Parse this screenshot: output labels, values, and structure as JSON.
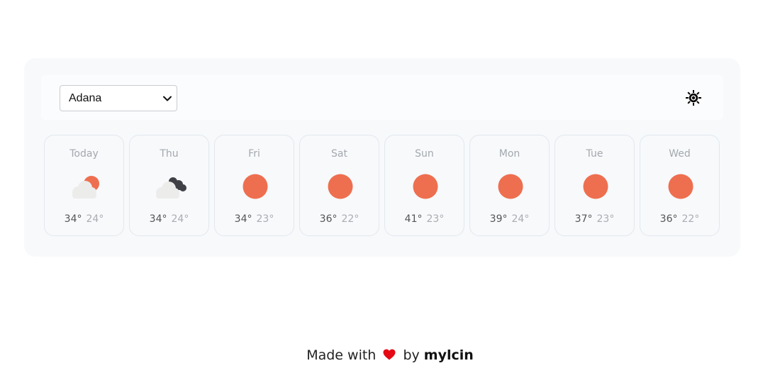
{
  "location": {
    "selected_city": "Adana"
  },
  "header": {
    "theme_icon": "sun-icon"
  },
  "forecast": [
    {
      "day": "Today",
      "high": "34°",
      "low": "24°",
      "condition": "partly-cloudy"
    },
    {
      "day": "Thu",
      "high": "34°",
      "low": "24°",
      "condition": "cloudy-rain"
    },
    {
      "day": "Fri",
      "high": "34°",
      "low": "23°",
      "condition": "sunny"
    },
    {
      "day": "Sat",
      "high": "36°",
      "low": "22°",
      "condition": "sunny"
    },
    {
      "day": "Sun",
      "high": "41°",
      "low": "23°",
      "condition": "sunny"
    },
    {
      "day": "Mon",
      "high": "39°",
      "low": "24°",
      "condition": "sunny"
    },
    {
      "day": "Tue",
      "high": "37°",
      "low": "23°",
      "condition": "sunny"
    },
    {
      "day": "Wed",
      "high": "36°",
      "low": "22°",
      "condition": "sunny"
    }
  ],
  "footer": {
    "prefix": "Made with",
    "middle": "by",
    "author": "mylcin"
  },
  "colors": {
    "sun": "#ee6f4f",
    "cloud_light": "#ececeb",
    "cloud_dark": "#3f4147",
    "heart": "#e50914"
  }
}
